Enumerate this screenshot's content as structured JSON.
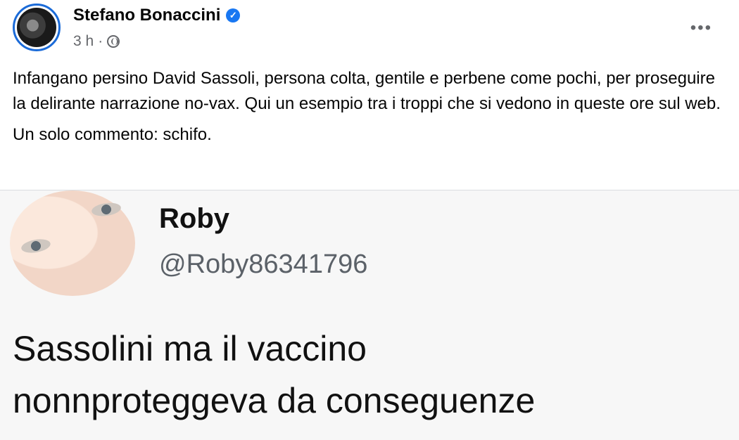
{
  "post": {
    "author": "Stefano Bonaccini",
    "verified_glyph": "✓",
    "time": "3 h",
    "meta_sep": "·",
    "audience_icon": "globe-icon",
    "more_label": "•••",
    "paragraphs": [
      "Infangano persino David Sassoli, persona colta, gentile e perbene come pochi, per proseguire la delirante narrazione no-vax. Qui un esempio tra i troppi che si vedono in queste ore sul web.",
      "Un solo commento: schifo."
    ]
  },
  "embedded_tweet": {
    "name": "Roby",
    "handle": "@Roby86341796",
    "text_lines": [
      "Sassolini ma il vaccino",
      "nonnproteggeva da conseguenze"
    ]
  },
  "colors": {
    "verified": "#1877f2",
    "avatar_ring": "#1b6bd8",
    "meta_text": "#65676b"
  }
}
